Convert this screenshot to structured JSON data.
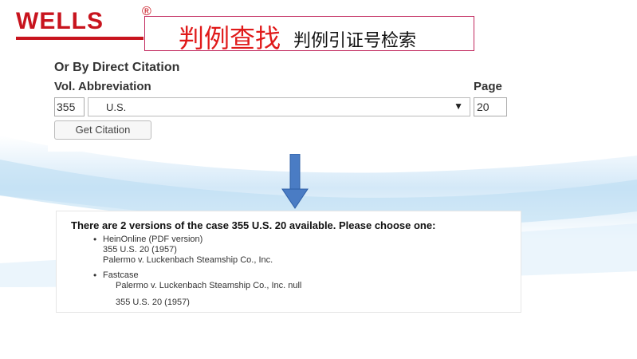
{
  "logo": {
    "text": "WELLS",
    "registered": "®"
  },
  "title": {
    "large": "判例查找",
    "small": "判例引证号检索"
  },
  "citation_form": {
    "heading": "Or By Direct Citation",
    "vol_abbr_label": "Vol. Abbreviation",
    "page_label": "Page",
    "vol_value": "355",
    "abbreviation_selected": "U.S.",
    "page_value": "20",
    "button_label": "Get Citation"
  },
  "results": {
    "heading": "There are 2 versions of the case 355 U.S. 20 available. Please choose one:",
    "items": [
      {
        "link": "HeinOnline (PDF version)",
        "line1": "355 U.S. 20 (1957)",
        "line2": "Palermo v. Luckenbach Steamship Co., Inc."
      },
      {
        "link": "Fastcase",
        "line1": "Palermo v. Luckenbach Steamship Co., Inc. null",
        "line2": "355 U.S. 20 (1957)"
      }
    ]
  },
  "colors": {
    "brand_red": "#c8141e",
    "title_red": "#e01a1a",
    "arrow_blue": "#4a7cc4",
    "link_blue": "#2a6cc0"
  }
}
